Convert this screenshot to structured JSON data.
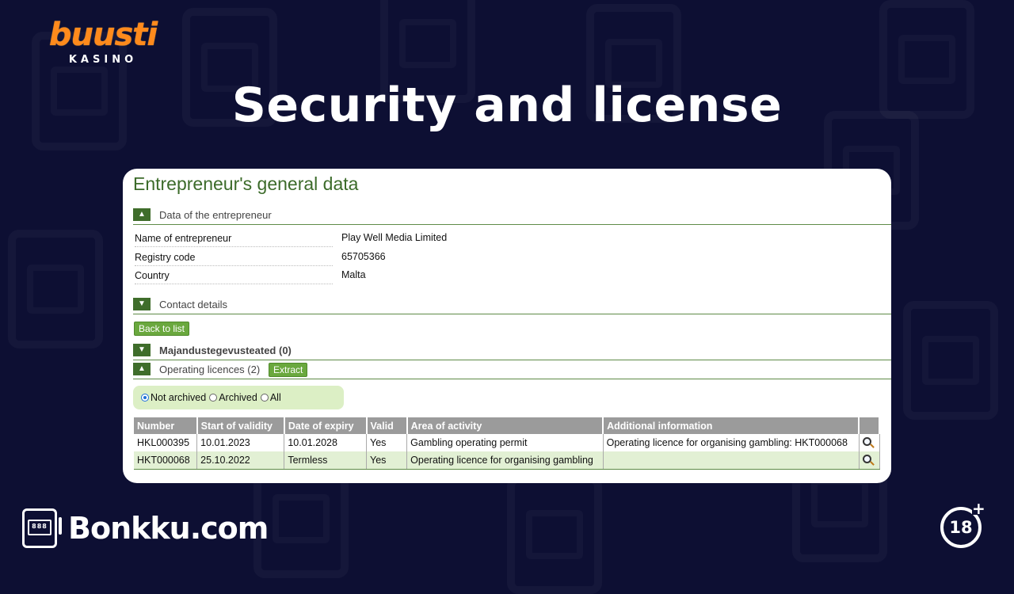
{
  "brand": {
    "name": "buusti",
    "sub": "KASINO"
  },
  "headline": "Security and license",
  "card": {
    "title": "Entrepreneur's general data",
    "sections": {
      "entrepreneur": "Data of the entrepreneur",
      "contact": "Contact details",
      "economic": "Majandustegevusteated (0)",
      "licences": "Operating licences (2)"
    },
    "fields": [
      {
        "label": "Name of entrepreneur",
        "value": "Play Well Media Limited"
      },
      {
        "label": "Registry code",
        "value": "65705366"
      },
      {
        "label": "Country",
        "value": "Malta"
      }
    ],
    "buttons": {
      "back": "Back to list",
      "extract": "Extract"
    },
    "filter": {
      "selected": "Not archived",
      "options": [
        "Not archived",
        "Archived",
        "All"
      ]
    },
    "table": {
      "headers": [
        "Number",
        "Start of validity",
        "Date of expiry",
        "Valid",
        "Area of activity",
        "Additional information",
        ""
      ],
      "rows": [
        [
          "HKL000395",
          "10.01.2023",
          "10.01.2028",
          "Yes",
          "Gambling operating permit",
          "Operating licence for organising gambling: HKT000068"
        ],
        [
          "HKT000068",
          "25.10.2022",
          "Termless",
          "Yes",
          "Operating licence for organising gambling",
          ""
        ]
      ]
    }
  },
  "footer": {
    "site": "Bonkku.com",
    "age": "18",
    "age_plus": "+"
  },
  "icons": {
    "toggle_up": "chevron-up-icon",
    "toggle_down": "chevron-down-icon",
    "view": "magnifier-icon",
    "slot": "slot-machine-icon"
  },
  "colors": {
    "background": "#0d0f33",
    "brand": "#ff8a1c",
    "green_dark": "#3f6d2b",
    "green_button": "#6aa83e",
    "row_alt": "#e2f0d4"
  }
}
